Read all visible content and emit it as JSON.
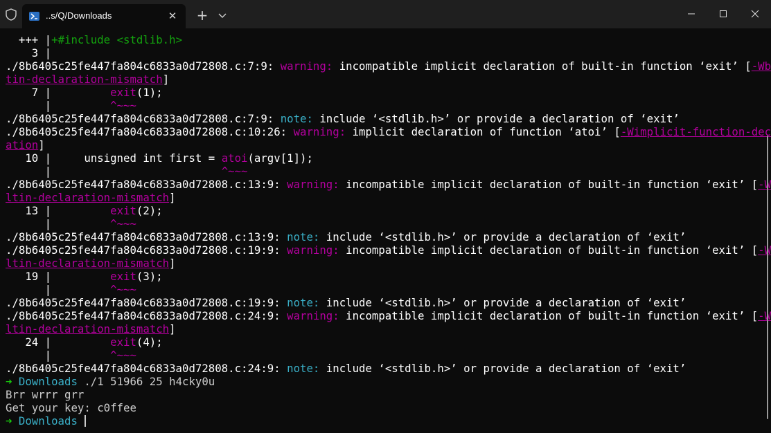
{
  "window": {
    "tab_title": "..s/Q/Downloads",
    "tab_icon": "powershell-icon",
    "buttons": [
      "minimize-icon",
      "maximize-icon",
      "close-icon"
    ]
  },
  "terminal": {
    "lines": [
      [
        {
          "t": "  +++ |",
          "k": "w"
        },
        {
          "t": "+#include <stdlib.h>",
          "k": "g"
        }
      ],
      [
        {
          "t": "    3 |",
          "k": "w"
        }
      ],
      [
        {
          "t": "./8b6405c25fe447fa804c6833a0d72808.c:7:9: ",
          "k": "w"
        },
        {
          "t": "warning:",
          "k": "m"
        },
        {
          "t": " incompatible implicit declaration of built-in function ‘",
          "k": "w"
        },
        {
          "t": "exit",
          "k": "wb"
        },
        {
          "t": "’ [",
          "k": "w"
        },
        {
          "t": "-Wbuil",
          "k": "mu"
        }
      ],
      [
        {
          "t": "tin-declaration-mismatch",
          "k": "mu"
        },
        {
          "t": "]",
          "k": "w"
        }
      ],
      [
        {
          "t": "    7 |         ",
          "k": "w"
        },
        {
          "t": "exit",
          "k": "m"
        },
        {
          "t": "(1);",
          "k": "w"
        }
      ],
      [
        {
          "t": "      |         ",
          "k": "w"
        },
        {
          "t": "^~~~",
          "k": "m"
        }
      ],
      [
        {
          "t": "./8b6405c25fe447fa804c6833a0d72808.c:7:9: ",
          "k": "w"
        },
        {
          "t": "note:",
          "k": "cy"
        },
        {
          "t": " include ‘",
          "k": "w"
        },
        {
          "t": "<stdlib.h>",
          "k": "wb"
        },
        {
          "t": "’ or provide a declaration of ‘",
          "k": "w"
        },
        {
          "t": "exit",
          "k": "wb"
        },
        {
          "t": "’",
          "k": "w"
        }
      ],
      [
        {
          "t": "./8b6405c25fe447fa804c6833a0d72808.c:10:26: ",
          "k": "w"
        },
        {
          "t": "warning:",
          "k": "m"
        },
        {
          "t": " implicit declaration of function ‘",
          "k": "w"
        },
        {
          "t": "atoi",
          "k": "wb"
        },
        {
          "t": "’ [",
          "k": "w"
        },
        {
          "t": "-Wimplicit-function-declar",
          "k": "mu"
        }
      ],
      [
        {
          "t": "ation",
          "k": "mu"
        },
        {
          "t": "]",
          "k": "w"
        }
      ],
      [
        {
          "t": "   10 |     unsigned int first = ",
          "k": "w"
        },
        {
          "t": "atoi",
          "k": "m"
        },
        {
          "t": "(argv[1]);",
          "k": "w"
        }
      ],
      [
        {
          "t": "      |                          ",
          "k": "w"
        },
        {
          "t": "^~~~",
          "k": "m"
        }
      ],
      [
        {
          "t": "./8b6405c25fe447fa804c6833a0d72808.c:13:9: ",
          "k": "w"
        },
        {
          "t": "warning:",
          "k": "m"
        },
        {
          "t": " incompatible implicit declaration of built-in function ‘",
          "k": "w"
        },
        {
          "t": "exit",
          "k": "wb"
        },
        {
          "t": "’ [",
          "k": "w"
        },
        {
          "t": "-Wbui",
          "k": "mu"
        }
      ],
      [
        {
          "t": "ltin-declaration-mismatch",
          "k": "mu"
        },
        {
          "t": "]",
          "k": "w"
        }
      ],
      [
        {
          "t": "   13 |         ",
          "k": "w"
        },
        {
          "t": "exit",
          "k": "m"
        },
        {
          "t": "(2);",
          "k": "w"
        }
      ],
      [
        {
          "t": "      |         ",
          "k": "w"
        },
        {
          "t": "^~~~",
          "k": "m"
        }
      ],
      [
        {
          "t": "./8b6405c25fe447fa804c6833a0d72808.c:13:9: ",
          "k": "w"
        },
        {
          "t": "note:",
          "k": "cy"
        },
        {
          "t": " include ‘",
          "k": "w"
        },
        {
          "t": "<stdlib.h>",
          "k": "wb"
        },
        {
          "t": "’ or provide a declaration of ‘",
          "k": "w"
        },
        {
          "t": "exit",
          "k": "wb"
        },
        {
          "t": "’",
          "k": "w"
        }
      ],
      [
        {
          "t": "./8b6405c25fe447fa804c6833a0d72808.c:19:9: ",
          "k": "w"
        },
        {
          "t": "warning:",
          "k": "m"
        },
        {
          "t": " incompatible implicit declaration of built-in function ‘",
          "k": "w"
        },
        {
          "t": "exit",
          "k": "wb"
        },
        {
          "t": "’ [",
          "k": "w"
        },
        {
          "t": "-Wbui",
          "k": "mu"
        }
      ],
      [
        {
          "t": "ltin-declaration-mismatch",
          "k": "mu"
        },
        {
          "t": "]",
          "k": "w"
        }
      ],
      [
        {
          "t": "   19 |         ",
          "k": "w"
        },
        {
          "t": "exit",
          "k": "m"
        },
        {
          "t": "(3);",
          "k": "w"
        }
      ],
      [
        {
          "t": "      |         ",
          "k": "w"
        },
        {
          "t": "^~~~",
          "k": "m"
        }
      ],
      [
        {
          "t": "./8b6405c25fe447fa804c6833a0d72808.c:19:9: ",
          "k": "w"
        },
        {
          "t": "note:",
          "k": "cy"
        },
        {
          "t": " include ‘",
          "k": "w"
        },
        {
          "t": "<stdlib.h>",
          "k": "wb"
        },
        {
          "t": "’ or provide a declaration of ‘",
          "k": "w"
        },
        {
          "t": "exit",
          "k": "wb"
        },
        {
          "t": "’",
          "k": "w"
        }
      ],
      [
        {
          "t": "./8b6405c25fe447fa804c6833a0d72808.c:24:9: ",
          "k": "w"
        },
        {
          "t": "warning:",
          "k": "m"
        },
        {
          "t": " incompatible implicit declaration of built-in function ‘",
          "k": "w"
        },
        {
          "t": "exit",
          "k": "wb"
        },
        {
          "t": "’ [",
          "k": "w"
        },
        {
          "t": "-Wbui",
          "k": "mu"
        }
      ],
      [
        {
          "t": "ltin-declaration-mismatch",
          "k": "mu"
        },
        {
          "t": "]",
          "k": "w"
        }
      ],
      [
        {
          "t": "   24 |         ",
          "k": "w"
        },
        {
          "t": "exit",
          "k": "m"
        },
        {
          "t": "(4);",
          "k": "w"
        }
      ],
      [
        {
          "t": "      |         ",
          "k": "w"
        },
        {
          "t": "^~~~",
          "k": "m"
        }
      ],
      [
        {
          "t": "./8b6405c25fe447fa804c6833a0d72808.c:24:9: ",
          "k": "w"
        },
        {
          "t": "note:",
          "k": "cy"
        },
        {
          "t": " include ‘",
          "k": "w"
        },
        {
          "t": "<stdlib.h>",
          "k": "wb"
        },
        {
          "t": "’ or provide a declaration of ‘",
          "k": "w"
        },
        {
          "t": "exit",
          "k": "wb"
        },
        {
          "t": "’",
          "k": "w"
        }
      ],
      [
        {
          "t": "➜ ",
          "k": "arrow"
        },
        {
          "t": "Downloads",
          "k": "cy"
        },
        {
          "t": " ./1 51966 25 h4cky0u",
          "k": "n"
        }
      ],
      [
        {
          "t": "Brr wrrr grr",
          "k": "n"
        }
      ],
      [
        {
          "t": "Get your key: c0ffee",
          "k": "n"
        }
      ],
      [
        {
          "t": "➜ ",
          "k": "arrow"
        },
        {
          "t": "Downloads",
          "k": "cy"
        },
        {
          "t": " ",
          "k": "n"
        },
        {
          "t": "",
          "k": "cursor"
        }
      ]
    ]
  },
  "colors": {
    "background": "#0c0c0c",
    "titlebar": "#1f1f1f",
    "warning": "#b4009e",
    "note": "#3ab0c8",
    "include_green": "#13a10e",
    "prompt_arrow": "#16c60c"
  }
}
